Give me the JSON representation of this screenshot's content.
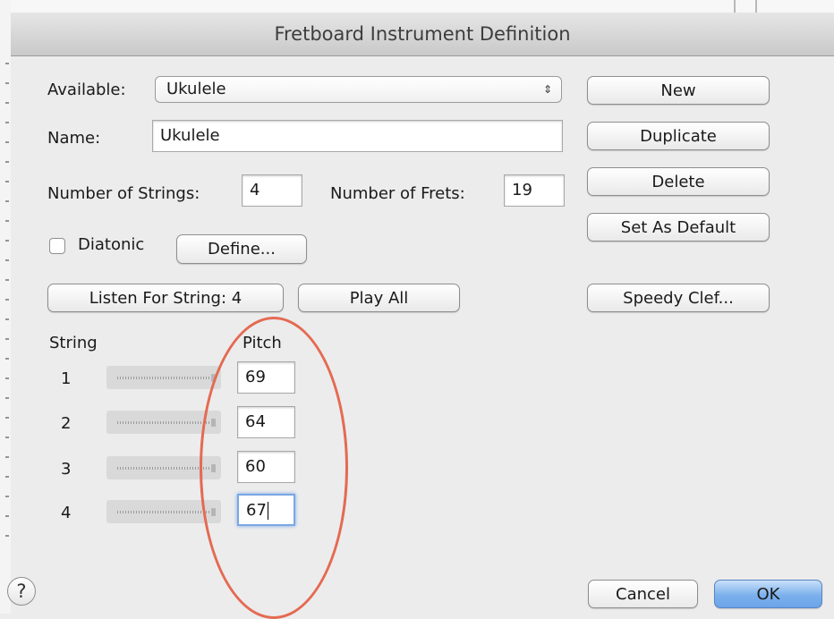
{
  "window": {
    "title": "Fretboard Instrument Definition"
  },
  "available": {
    "label": "Available:",
    "selected": "Ukulele",
    "arrows": "⇕"
  },
  "name": {
    "label": "Name:",
    "value": "Ukulele"
  },
  "strings": {
    "label": "Number of Strings:",
    "value": "4"
  },
  "frets": {
    "label": "Number of Frets:",
    "value": "19"
  },
  "diatonic": {
    "label": "Diatonic",
    "checked": false
  },
  "buttons": {
    "define": "Define...",
    "listen": "Listen For String: 4",
    "play_all": "Play All",
    "new": "New",
    "duplicate": "Duplicate",
    "delete": "Delete",
    "set_default": "Set As Default",
    "speedy_clef": "Speedy Clef...",
    "cancel": "Cancel",
    "ok": "OK"
  },
  "table": {
    "string_header": "String",
    "pitch_header": "Pitch",
    "rows": [
      {
        "string": "1",
        "pitch": "69"
      },
      {
        "string": "2",
        "pitch": "64"
      },
      {
        "string": "3",
        "pitch": "60"
      },
      {
        "string": "4",
        "pitch": "67"
      }
    ]
  },
  "help": {
    "symbol": "?"
  },
  "colors": {
    "annotation": "#e46a52",
    "default_button": "#6aa4ea",
    "focus_ring": "#7aa7e6"
  }
}
